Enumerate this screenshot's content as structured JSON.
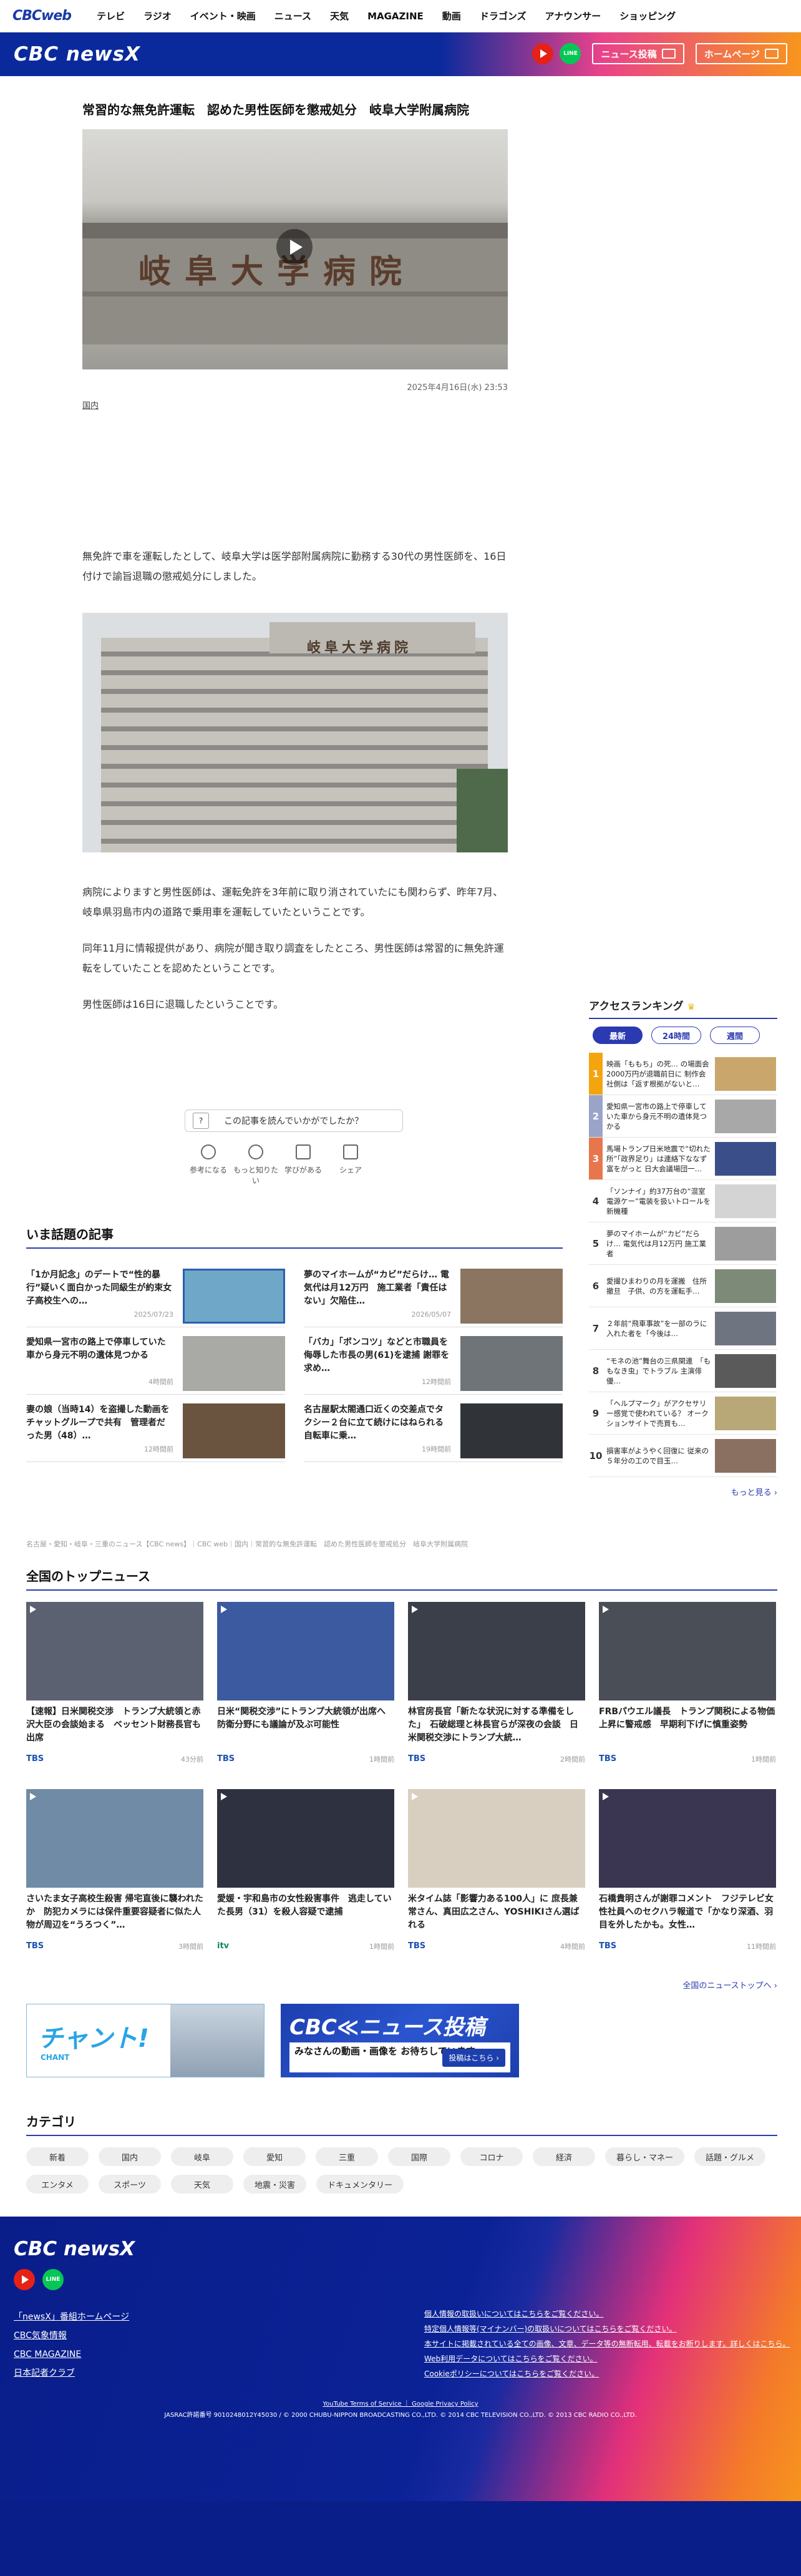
{
  "topnav": {
    "brand": "CBCweb",
    "items": [
      "テレビ",
      "ラジオ",
      "イベント・映画",
      "ニュース",
      "天気",
      "MAGAZINE",
      "動画",
      "ドラゴンズ",
      "アナウンサー",
      "ショッピング"
    ]
  },
  "header": {
    "logo": "CBC newsX",
    "news_post": "ニュース投稿",
    "homepage": "ホームページ"
  },
  "article": {
    "title": "常習的な無免許運転　認めた男性医師を懲戒処分　岐阜大学附属病院",
    "hero_sign": "岐阜大学病院",
    "date": "2025年4月16日(水) 23:53",
    "category": "国内",
    "p1": "無免許で車を運転したとして、岐阜大学は医学部附属病院に勤務する30代の男性医師を、16日付けで諭旨退職の懲戒処分にしました。",
    "img2_sign": "岐阜大学病院",
    "p2": "病院によりますと男性医師は、運転免許を3年前に取り消されていたにも関わらず、昨年7月、岐阜県羽島市内の道路で乗用車を運転していたということです。",
    "p3": "同年11月に情報提供があり、病院が聞き取り調査をしたところ、男性医師は常習的に無免許運転をしていたことを認めたということです。",
    "p4": "男性医師は16日に退職したということです。",
    "feedback": "この記事を読んでいかがでしたか？",
    "reactions": [
      "参考になる",
      "もっと知りたい",
      "学びがある",
      "シェア"
    ]
  },
  "hot": {
    "title": "いま話題の記事",
    "items": [
      {
        "text": "「1か月記念」のデートで“性的暴行”疑いく面白かった同級生が約束女子高校生への…",
        "time": "2025/07/23"
      },
      {
        "text": "夢のマイホームが“カビ”だらけ… 電気代は月12万円　施工業者「責任はない」欠陥住…",
        "time": "2026/05/07"
      },
      {
        "text": "愛知県一宮市の路上で停車していた車から身元不明の遺体見つかる",
        "time": "4時間前"
      },
      {
        "text": "「バカ」「ボンコツ」などと市職員を侮辱した市長の男(61)を逮捕 謝罪を求め…",
        "time": "12時間前"
      },
      {
        "text": "妻の娘（当時14）を盗撮した動画をチャットグループで共有　管理者だった男（48）…",
        "time": "12時間前"
      },
      {
        "text": "名古屋駅太閤通口近くの交差点でタクシー２台に立て続けにはねられる　自転車に乗…",
        "time": "19時間前"
      }
    ]
  },
  "breadcrumb": "名古屋・愛知・岐阜・三重のニュース【CBC news】｜CBC web｜国内｜常習的な無免許運転　認めた男性医師を懲戒処分　岐阜大学附属病院",
  "ranking": {
    "title": "アクセスランキング",
    "crown": "♛",
    "tabs": [
      "最新",
      "24時間",
      "週間"
    ],
    "items": [
      "映画「ももち」の死… の場面会2000万円が退職前日に 制作会社側は「返す根拠がないと…",
      "愛知県一宮市の路上で停車していた車から身元不明の遺体見つかる",
      "馬場トランプ日米地震で“切れた所”「政界足り」は連絡下ななず富をがっと 日大会議場団一…",
      "「ソンナイ」約37万台の“混室電源ケー”電装を扱いトロールを新機種",
      "夢のマイホームが“カビ”だらけ… 電気代は月12万円 施工業者",
      "愛撮ひまわりの月を運搬　住所撤旦　子供、の方を運転手…",
      "２年前“飛車事故”を一部のラに入れた者を「今後は…",
      "“モネの池”舞台の三県関連　「ももなき虫」でトラブル 主演俳優…",
      "「ヘルプマーク」がアクセサリー感覚で使われている？ オークションサイトで売買も…",
      "損害率がようやく回復に 従来の５年分の工ので目玉…"
    ],
    "more": "もっと見る ›"
  },
  "national": {
    "title": "全国のトップニュース",
    "items": [
      {
        "text": "【速報】日米関税交渉　トランプ大統領と赤沢大臣の会談始まる　ベッセント財務長官も出席",
        "src": "TBS",
        "time": "43分前"
      },
      {
        "text": "日米“関税交渉”にトランプ大統領が出席へ　防衛分野にも議論が及ぶ可能性",
        "src": "TBS",
        "time": "1時間前"
      },
      {
        "text": "林官房長官「新たな状況に対する準備をした」　石破総理と林長官らが深夜の会談　日米関税交渉にトランプ大統…",
        "src": "TBS",
        "time": "2時間前"
      },
      {
        "text": "FRBパウエル議長　トランプ関税による物価上昇に警戒感　早期利下げに慎重姿勢",
        "src": "TBS",
        "time": "1時間前"
      },
      {
        "text": "さいたま女子高校生殺害 帰宅直後に襲われたか　防犯カメラには保件重要容疑者に似た人物が周辺を“うろつく”…",
        "src": "TBS",
        "time": "3時間前"
      },
      {
        "text": "愛媛・宇和島市の女性殺害事件　逃走していた長男（31）を殺人容疑で逮捕",
        "src": "itv",
        "time": "1時間前"
      },
      {
        "text": "米タイム誌「影響力ある100人」に 庶長兼常さん、真田広之さん、YOSHIKIさん選ばれる",
        "src": "TBS",
        "time": "4時間前"
      },
      {
        "text": "石橋貴明さんが謝罪コメント　フジテレビ女性社員へのセクハラ報道で「かなり深酒、羽目を外したかも。女性…",
        "src": "TBS",
        "time": "11時間前"
      }
    ],
    "more": "全国のニューストップへ ›"
  },
  "banners": {
    "chant": "チャント!",
    "chant_sub": "CHANT",
    "post_title": "CBC≪ニュース投稿",
    "post_body": "みなさんの動画・画像を お待ちしています。",
    "post_btn": "投稿はこちら ›"
  },
  "categories": {
    "title": "カテゴリ",
    "chips": [
      "新着",
      "国内",
      "岐阜",
      "愛知",
      "三重",
      "国際",
      "コロナ",
      "経済",
      "暮らし・マネー",
      "話題・グルメ",
      "エンタメ",
      "スポーツ",
      "天気",
      "地震・災害",
      "ドキュメンタリー"
    ]
  },
  "footer": {
    "logo": "CBC newsX",
    "links_left": [
      "「newsX」番組ホームページ",
      "CBC気象情報",
      "CBC MAGAZINE",
      "日本記者クラブ"
    ],
    "links_right": [
      "個人情報の取扱いについてはこちらをご覧ください。",
      "特定個人情報等(マイナンバー)の取扱いについてはこちらをご覧ください。",
      "本サイトに掲載されている全ての画像、文章、データ等の無断転用、転載をお断りします。詳しくはこちら。",
      "Web利用データについてはこちらをご覧ください。",
      "Cookieポリシーについてはこちらをご覧ください。"
    ],
    "policies": "YouTube Terms of Service ｜ Google Privacy Policy",
    "copyright": "JASRAC許諾番号 9010248012Y45030 / © 2000 CHUBU-NIPPON BROADCASTING CO.,LTD. © 2014 CBC TELEVISION CO.,LTD. © 2013 CBC RADIO CO.,LTD."
  },
  "colors": {
    "brand_blue": "#0a2a9c",
    "accent_orange": "#f7951d",
    "accent_pink": "#e9428b"
  }
}
